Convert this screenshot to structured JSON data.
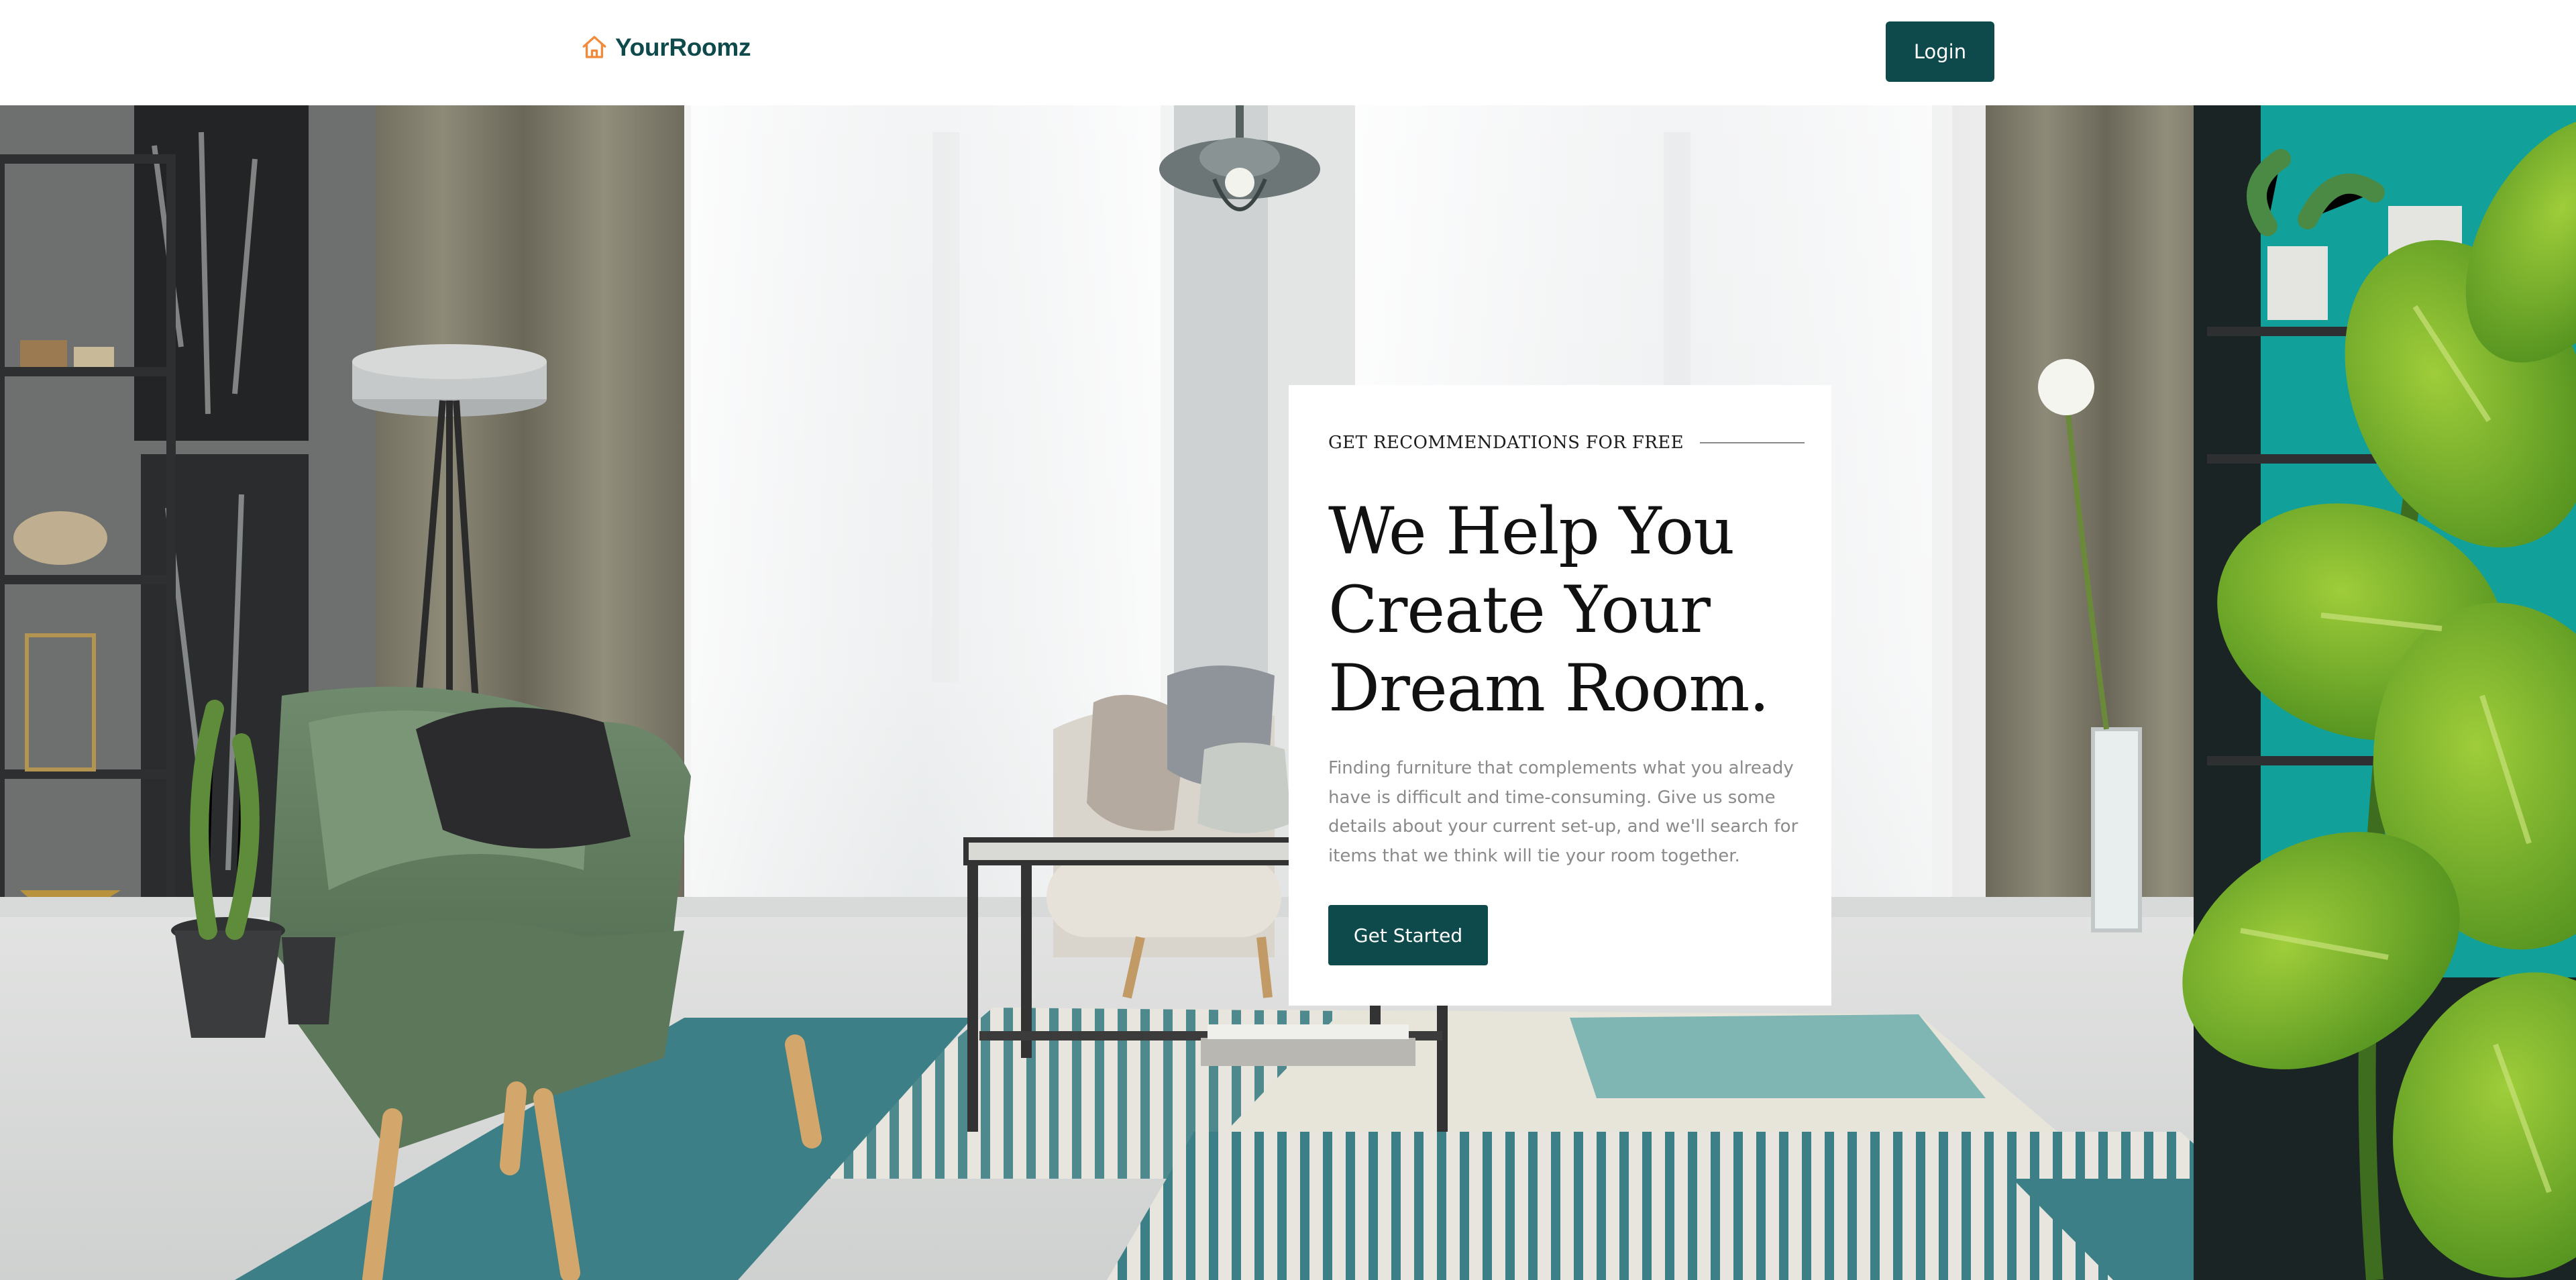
{
  "brand": {
    "name": "YourRoomz",
    "icon": "house-icon",
    "icon_color": "#f28a3c"
  },
  "nav": {
    "login_label": "Login"
  },
  "hero": {
    "image": "living-room-photo",
    "eyebrow": "GET RECOMMENDATIONS FOR FREE",
    "headline": [
      "We Help You",
      "Create Your",
      "Dream Room."
    ],
    "body": "Finding furniture that complements what you already have is difficult and time-consuming. Give us some details about your current set-up, and we'll search for items that we think will tie your room together.",
    "cta_label": "Get Started"
  },
  "colors": {
    "brand_primary": "#0e4a4c",
    "brand_accent": "#f28a3c",
    "body_text": "#8a8a8a",
    "heading_text": "#111111"
  }
}
